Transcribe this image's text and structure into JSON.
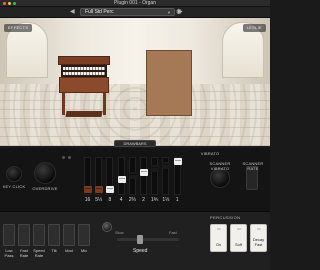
{
  "window": {
    "title": "Plugin 001 - Organ",
    "traffic_lights": [
      "#ff5f57",
      "#febc2e",
      "#28c840"
    ]
  },
  "toolbar": {
    "preset_name": "Full Std Perc",
    "prev_icon": "chevron-left-icon",
    "next_icon": "chevron-right-icon",
    "settings_icon": "gear-icon"
  },
  "stage": {
    "effects_button": "EFFECTS",
    "right_button": "LESLIE",
    "drawbars_tab": "DRAWBARS"
  },
  "controls": {
    "left_knob_1_label": "KEY CLICK",
    "left_knob_2_label": "OVERDRIVE",
    "vibrato_label": "VIBRATO",
    "right_knob_label": "SCANNER VIBRATO",
    "right_lever_label": "SCANNER RATE",
    "drawbar_labels": [
      "16",
      "5⅓",
      "8",
      "4",
      "2⅔",
      "2",
      "1⅗",
      "1⅓",
      "1"
    ],
    "drawbar_levels": [
      8,
      8,
      8,
      5,
      4,
      3,
      2,
      1,
      0
    ],
    "drawbar_colors": [
      "#7a3a1c",
      "#7a3a1c",
      "#eeeeee",
      "#eeeeee",
      "#1a1a1a",
      "#eeeeee",
      "#1a1a1a",
      "#1a1a1a",
      "#eeeeee"
    ]
  },
  "effects": [
    {
      "label": "Low Pass"
    },
    {
      "label": "Fast Rate"
    },
    {
      "label": "Speed Rate"
    },
    {
      "label": "Tilt"
    },
    {
      "label": "Mod"
    },
    {
      "label": "Mix"
    }
  ],
  "speed": {
    "label": "Speed",
    "slow_label": "Slow",
    "fast_label": "Fast",
    "value": 0.35
  },
  "percussion": {
    "title": "PERCUSSION",
    "buttons": [
      {
        "line1": "",
        "line2": "On"
      },
      {
        "line1": "",
        "line2": "Soft"
      },
      {
        "line1": "Decay",
        "line2": "Fast"
      }
    ]
  }
}
